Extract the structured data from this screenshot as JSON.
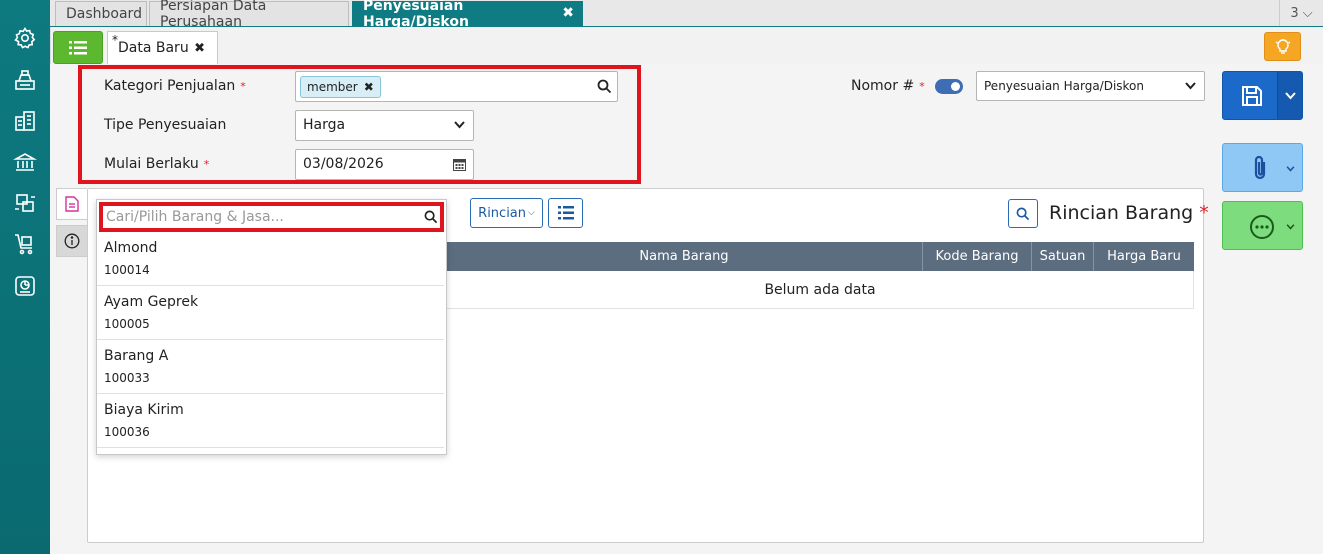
{
  "tabs": [
    {
      "label": "Dashboard"
    },
    {
      "label": "Persiapan Data Perusahaan"
    },
    {
      "label": "Penyesuaian Harga/Diskon",
      "close": "✖"
    }
  ],
  "tab_count": "3 ⌵",
  "subtab": {
    "star": "*",
    "label": "Data Baru",
    "close": "✖"
  },
  "form": {
    "kategori_label": "Kategori Penjualan",
    "kategori_chip": "member",
    "chip_remove": "✖",
    "tipe_label": "Tipe Penyesuaian",
    "tipe_value": "Harga",
    "mulai_label": "Mulai Berlaku",
    "mulai_value": "03/08/2026",
    "required_mark": "*",
    "nomor_label": "Nomor #",
    "nomor_select": "Penyesuaian Harga/Diskon"
  },
  "detail": {
    "search_placeholder": "Cari/Pilih Barang & Jasa...",
    "rincian_btn": "Rincian",
    "title": "Rincian Barang",
    "title_req": "*",
    "columns": [
      "Nama Barang",
      "Kode Barang",
      "Satuan",
      "Harga Baru"
    ],
    "empty": "Belum ada data"
  },
  "dropdown_items": [
    {
      "name": "Almond",
      "code": "100014"
    },
    {
      "name": "Ayam Geprek",
      "code": "100005"
    },
    {
      "name": "Barang A",
      "code": "100033"
    },
    {
      "name": "Biaya Kirim",
      "code": "100036"
    }
  ],
  "colors": {
    "teal": "#0f7b82",
    "accent_red": "#e0141e",
    "save_blue": "#1b69c9",
    "attach_blue": "#8fc7f5",
    "more_green": "#7ddc7d",
    "list_green": "#5cb82e",
    "bulb_orange": "#f5a623"
  }
}
